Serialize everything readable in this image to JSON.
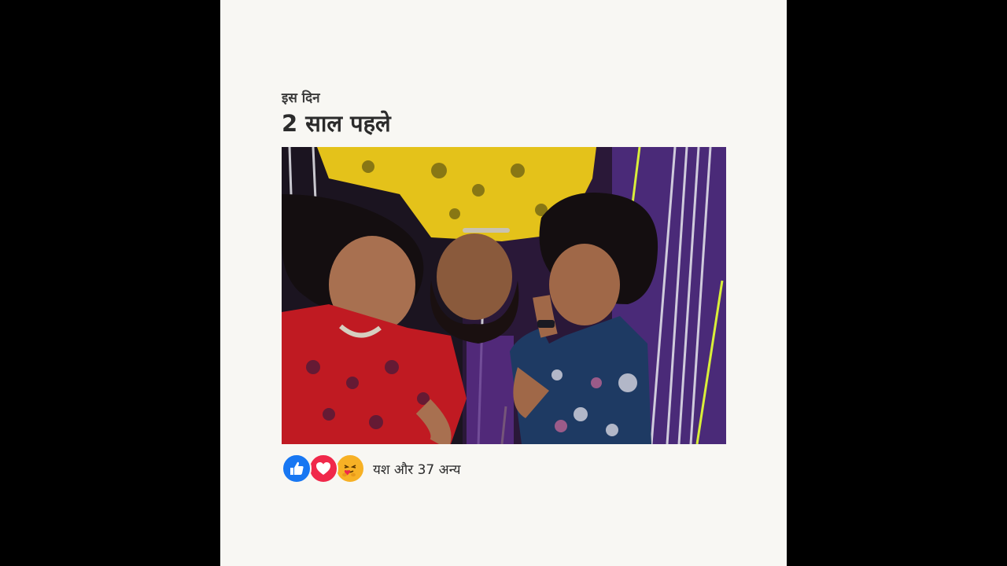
{
  "memory": {
    "eyebrow": "इस दिन",
    "headline": "2 साल पहले"
  },
  "photo": {
    "description_icon": "group-photo"
  },
  "reactions": {
    "icons": [
      "like-icon",
      "love-icon",
      "care-icon"
    ],
    "summary": "यश और 37 अन्य"
  },
  "colors": {
    "background": "#000000",
    "card": "#f8f7f3",
    "like": "#1877f2",
    "love": "#f0284a",
    "care": "#f7b125"
  }
}
